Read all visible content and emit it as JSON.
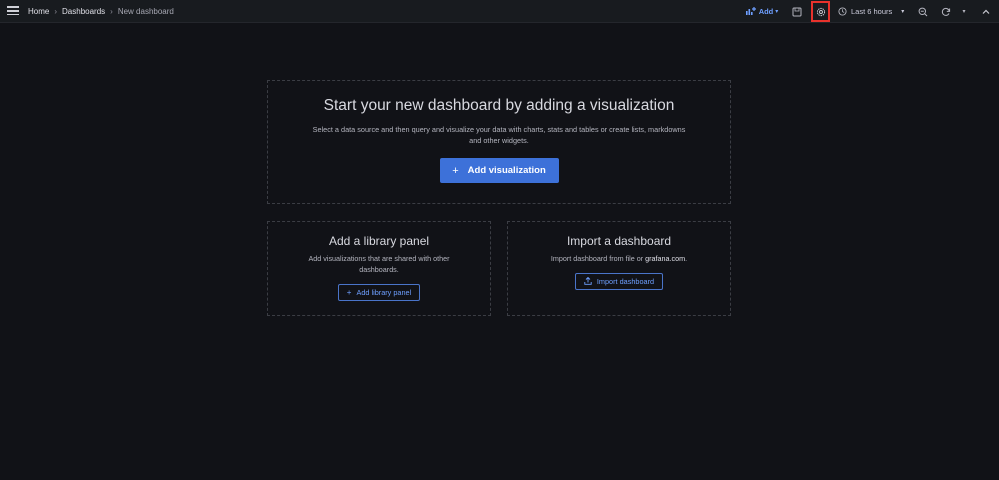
{
  "breadcrumbs": {
    "home": "Home",
    "dashboards": "Dashboards",
    "current": "New dashboard",
    "separator": "›"
  },
  "toolbar": {
    "add_label": "Add",
    "time_range": "Last 6 hours",
    "icons": [
      "menu-icon",
      "add-panel-icon",
      "save-icon",
      "settings-icon",
      "clock-icon",
      "zoom-out-icon",
      "refresh-icon",
      "chevron-down-icon",
      "chevron-up-icon"
    ],
    "highlight_color": "#e8322c"
  },
  "main": {
    "title": "Start your new dashboard by adding a visualization",
    "description": "Select a data source and then query and visualize your data with charts, stats and tables or create lists, markdowns and other widgets.",
    "button_label": "Add visualization",
    "button_color": "#3d71d9"
  },
  "library_panel": {
    "title": "Add a library panel",
    "description": "Add visualizations that are shared with other dashboards.",
    "button_label": "Add library panel"
  },
  "import_dashboard": {
    "title": "Import a dashboard",
    "description_prefix": "Import dashboard from file or ",
    "description_link": "grafana.com",
    "description_suffix": ".",
    "button_label": "Import dashboard"
  }
}
